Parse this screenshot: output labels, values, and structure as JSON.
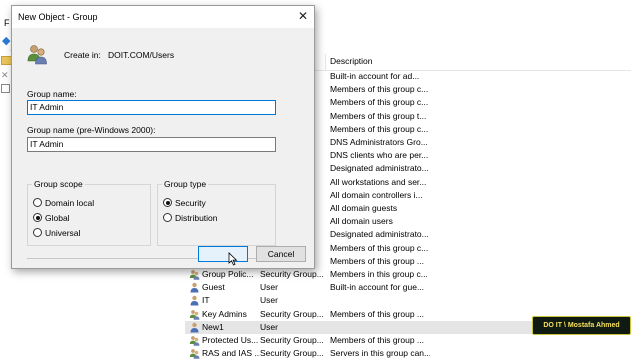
{
  "background": {
    "menu_letter": "F",
    "list": {
      "description_header": "Description",
      "rows": [
        {
          "name": "",
          "type": "",
          "desc": "Built-in account for ad...",
          "icon": "user-icon",
          "selected": false
        },
        {
          "name": "",
          "type": "",
          "desc": "Members of this group c...",
          "icon": "group-icon",
          "selected": false
        },
        {
          "name": "",
          "type": "",
          "desc": "Members of this group c...",
          "icon": "group-icon",
          "selected": false
        },
        {
          "name": "",
          "type": "",
          "desc": "Members of this group t...",
          "icon": "group-icon",
          "selected": false
        },
        {
          "name": "",
          "type": "",
          "desc": "Members of this group c...",
          "icon": "group-icon",
          "selected": false
        },
        {
          "name": "",
          "type": "",
          "desc": "DNS Administrators Gro...",
          "icon": "group-icon",
          "selected": false
        },
        {
          "name": "",
          "type": "",
          "desc": "DNS clients who are per...",
          "icon": "group-icon",
          "selected": false
        },
        {
          "name": "",
          "type": "",
          "desc": "Designated administrato...",
          "icon": "group-icon",
          "selected": false
        },
        {
          "name": "",
          "type": "",
          "desc": "All workstations and ser...",
          "icon": "group-icon",
          "selected": false
        },
        {
          "name": "",
          "type": "",
          "desc": "All domain controllers i...",
          "icon": "group-icon",
          "selected": false
        },
        {
          "name": "",
          "type": "",
          "desc": "All domain guests",
          "icon": "group-icon",
          "selected": false
        },
        {
          "name": "",
          "type": "",
          "desc": "All domain users",
          "icon": "group-icon",
          "selected": false
        },
        {
          "name": "",
          "type": "",
          "desc": "Designated administrato...",
          "icon": "group-icon",
          "selected": false
        },
        {
          "name": "",
          "type": "",
          "desc": "Members of this group c...",
          "icon": "group-icon",
          "selected": false
        },
        {
          "name": "",
          "type": "",
          "desc": "Members of this group ...",
          "icon": "group-icon",
          "selected": false
        },
        {
          "name": "Group Polic...",
          "type": "Security Group...",
          "desc": "Members in this group c...",
          "icon": "group-icon",
          "selected": false
        },
        {
          "name": "Guest",
          "type": "User",
          "desc": "Built-in account for gue...",
          "icon": "user-icon",
          "selected": false
        },
        {
          "name": "IT",
          "type": "User",
          "desc": "",
          "icon": "user-icon",
          "selected": false
        },
        {
          "name": "Key Admins",
          "type": "Security Group...",
          "desc": "Members of this group ...",
          "icon": "group-icon",
          "selected": false
        },
        {
          "name": "New1",
          "type": "User",
          "desc": "",
          "icon": "user-icon",
          "selected": true
        },
        {
          "name": "Protected Us...",
          "type": "Security Group...",
          "desc": "Members of this group ...",
          "icon": "group-icon",
          "selected": false
        },
        {
          "name": "RAS and IAS ...",
          "type": "Security Group...",
          "desc": "Servers in this group can...",
          "icon": "group-icon",
          "selected": false
        }
      ]
    }
  },
  "dialog": {
    "title": "New Object - Group",
    "close_symbol": "✕",
    "create_in_label": "Create in:",
    "create_in_value": "DOIT.COM/Users",
    "group_name_label": "Group name:",
    "group_name_value": "IT Admin",
    "group_name_pre2000_label": "Group name (pre-Windows 2000):",
    "group_name_pre2000_value": "IT Admin",
    "group_scope": {
      "title": "Group scope",
      "options": [
        "Domain local",
        "Global",
        "Universal"
      ],
      "selected": "Global"
    },
    "group_type": {
      "title": "Group type",
      "options": [
        "Security",
        "Distribution"
      ],
      "selected": "Security"
    },
    "ok_label": "",
    "cancel_label": "Cancel"
  },
  "watermark": "DO IT \\ Mostafa Ahmed",
  "colors": {
    "accent": "#0078d7",
    "selected_row": "#e5e5e5",
    "dialog_bg": "#f0f0f0",
    "watermark_bg": "#0f1a12",
    "watermark_text": "#f4e05a"
  }
}
